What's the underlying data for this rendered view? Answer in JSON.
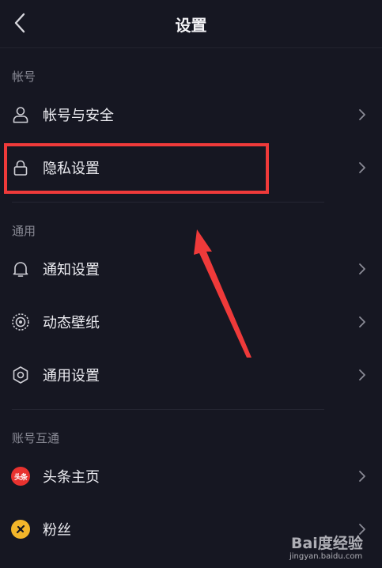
{
  "header": {
    "title": "设置"
  },
  "sections": {
    "account": {
      "label": "帐号",
      "items": [
        {
          "label": "帐号与安全",
          "icon": "user-icon"
        },
        {
          "label": "隐私设置",
          "icon": "lock-icon"
        }
      ]
    },
    "general": {
      "label": "通用",
      "items": [
        {
          "label": "通知设置",
          "icon": "bell-icon"
        },
        {
          "label": "动态壁纸",
          "icon": "wallpaper-icon"
        },
        {
          "label": "通用设置",
          "icon": "gear-icon"
        }
      ]
    },
    "linked": {
      "label": "账号互通",
      "items": [
        {
          "label": "头条主页",
          "icon": "toutiao-logo-icon",
          "badge_text": "头条"
        },
        {
          "label": "粉丝",
          "icon": "fans-logo-icon"
        }
      ]
    }
  },
  "annotation": {
    "highlight_color": "#ef3a3a"
  },
  "watermark": {
    "brand": "Bai度经验",
    "url": "jingyan.baidu.com"
  },
  "colors": {
    "background": "#161722",
    "text": "#ececf1",
    "muted": "#8a8b96",
    "accent": "#ef3a3a"
  }
}
